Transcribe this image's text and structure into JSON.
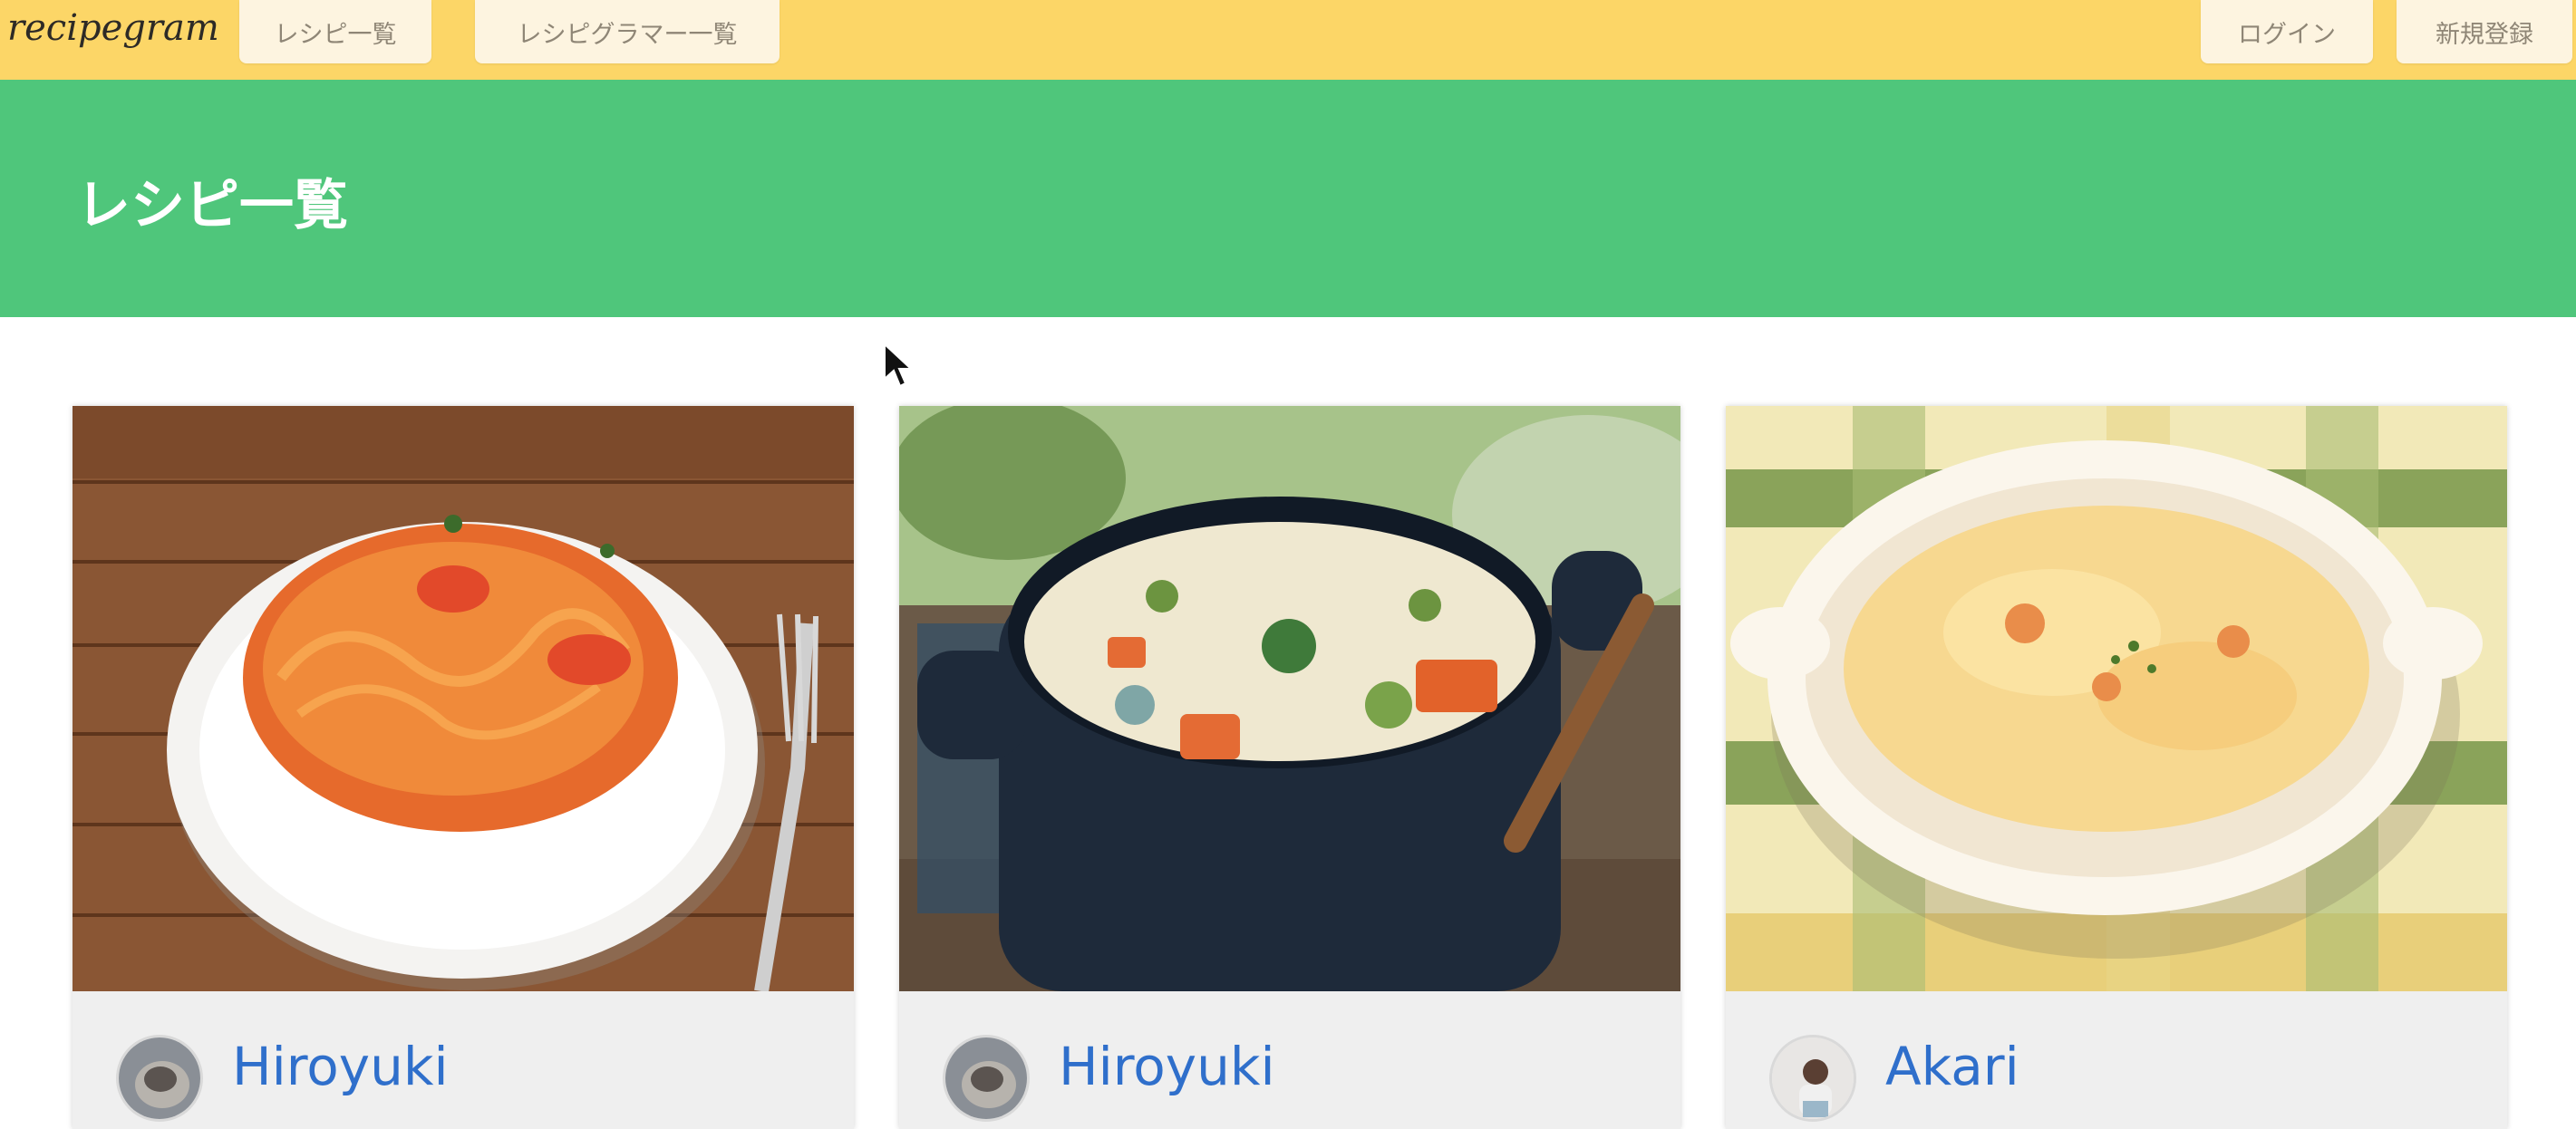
{
  "navbar": {
    "logo": "recipegram",
    "recipes_label": "レシピ一覧",
    "recipegramers_label": "レシピグラマー一覧",
    "login_label": "ログイン",
    "signup_label": "新規登録"
  },
  "hero": {
    "title": "レシピ一覧"
  },
  "cards": [
    {
      "author": "Hiroyuki",
      "photo_icon": "pasta-photo",
      "avatar_icon": "hiroyuki-avatar"
    },
    {
      "author": "Hiroyuki",
      "photo_icon": "cream-stew-photo",
      "avatar_icon": "hiroyuki-avatar"
    },
    {
      "author": "Akari",
      "photo_icon": "gratin-photo",
      "avatar_icon": "akari-avatar"
    }
  ],
  "colors": {
    "navbar": "#fcd667",
    "hero": "#4fc67b",
    "author_link": "#2f6fcb"
  }
}
